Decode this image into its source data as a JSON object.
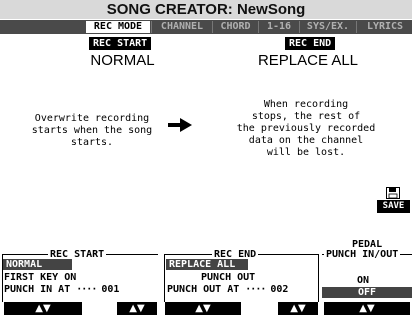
{
  "title": "SONG CREATOR: NewSong",
  "tabs": [
    {
      "label": "REC MODE",
      "active": true
    },
    {
      "label": "CHANNEL",
      "active": false
    },
    {
      "label": "CHORD",
      "active": false
    },
    {
      "label": "1-16",
      "active": false
    },
    {
      "label": "SYS/EX.",
      "active": false
    },
    {
      "label": "LYRICS",
      "active": false
    }
  ],
  "rec_start": {
    "tag": "REC START",
    "value": "NORMAL",
    "description": "Overwrite recording\nstarts when the song\nstarts."
  },
  "rec_end": {
    "tag": "REC END",
    "value": "REPLACE ALL",
    "description": "When recording\nstops, the rest of\nthe previously recorded\ndata on the channel\nwill be lost."
  },
  "save_label": "SAVE",
  "panels": {
    "rec_start": {
      "title": "REC START",
      "items": [
        "NORMAL",
        "FIRST KEY ON",
        "PUNCH IN AT"
      ],
      "selected": "NORMAL",
      "punch_value": "001"
    },
    "rec_end": {
      "title": "REC END",
      "items": [
        "REPLACE ALL",
        "PUNCH OUT",
        "PUNCH OUT AT"
      ],
      "selected": "REPLACE ALL",
      "punch_value": "002"
    },
    "pedal": {
      "title_line1": "PEDAL",
      "title_line2": "PUNCH IN/OUT",
      "items": [
        "ON",
        "OFF"
      ],
      "selected": "OFF"
    }
  },
  "buttons": [
    "▲▼",
    "▲▼",
    "▲▼",
    "▲▼",
    "▲▼"
  ]
}
